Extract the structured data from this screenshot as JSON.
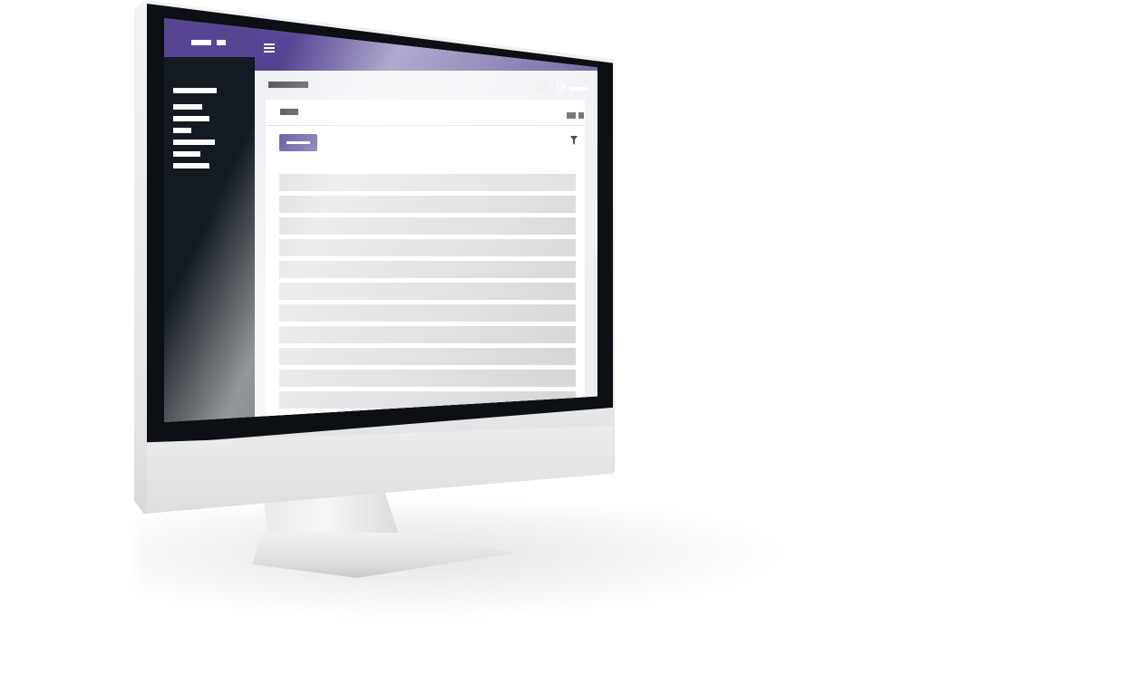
{
  "colors": {
    "brand": "#574594",
    "sidebar": "#131a21",
    "content_bg": "#eef0f4",
    "row": "#d7d7da"
  },
  "header": {
    "menu_icon": "hamburger-icon",
    "avatar_icon": "avatar",
    "logout_icon": "logout-icon"
  },
  "toolbar": {
    "filter_icon": "filter-icon"
  },
  "table": {
    "row_count": 11
  }
}
